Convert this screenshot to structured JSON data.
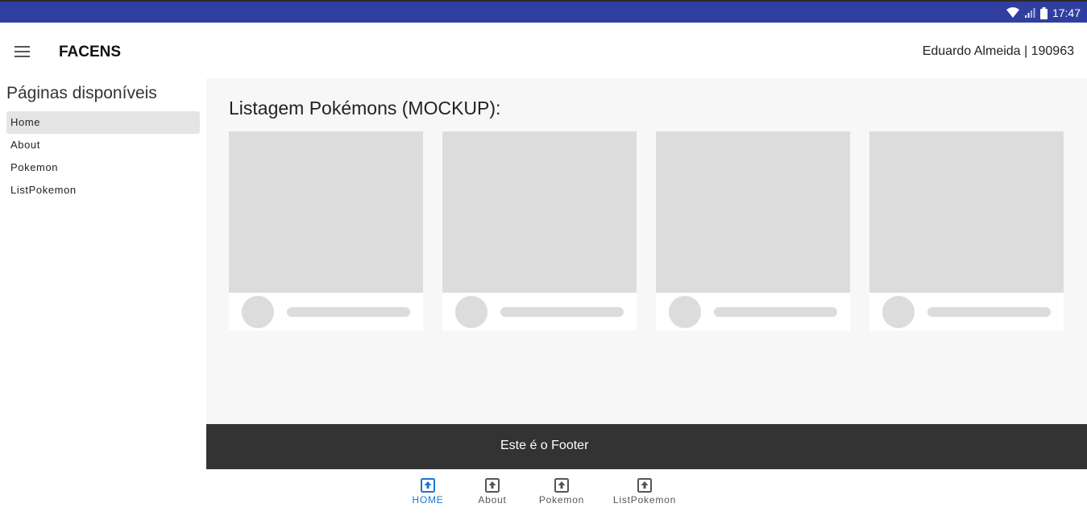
{
  "status_bar": {
    "time": "17:47",
    "icons": [
      "wifi-icon",
      "signal-icon",
      "battery-icon"
    ],
    "background": "#303f9f"
  },
  "header": {
    "title": "FACENS",
    "user": "Eduardo Almeida | 190963"
  },
  "sidebar": {
    "title": "Páginas disponíveis",
    "items": [
      {
        "label": "Home",
        "active": true
      },
      {
        "label": "About",
        "active": false
      },
      {
        "label": "Pokemon",
        "active": false
      },
      {
        "label": "ListPokemon",
        "active": false
      }
    ]
  },
  "main": {
    "title": "Listagem Pokémons (MOCKUP):",
    "card_count": 4
  },
  "footer": {
    "text": "Este é o Footer"
  },
  "bottom_nav": {
    "accent": "#1976d2",
    "items": [
      {
        "label": "HOME",
        "icon": "upload-box-icon",
        "active": true
      },
      {
        "label": "About",
        "icon": "upload-box-icon",
        "active": false
      },
      {
        "label": "Pokemon",
        "icon": "upload-box-icon",
        "active": false
      },
      {
        "label": "ListPokemon",
        "icon": "upload-box-icon",
        "active": false
      }
    ]
  }
}
